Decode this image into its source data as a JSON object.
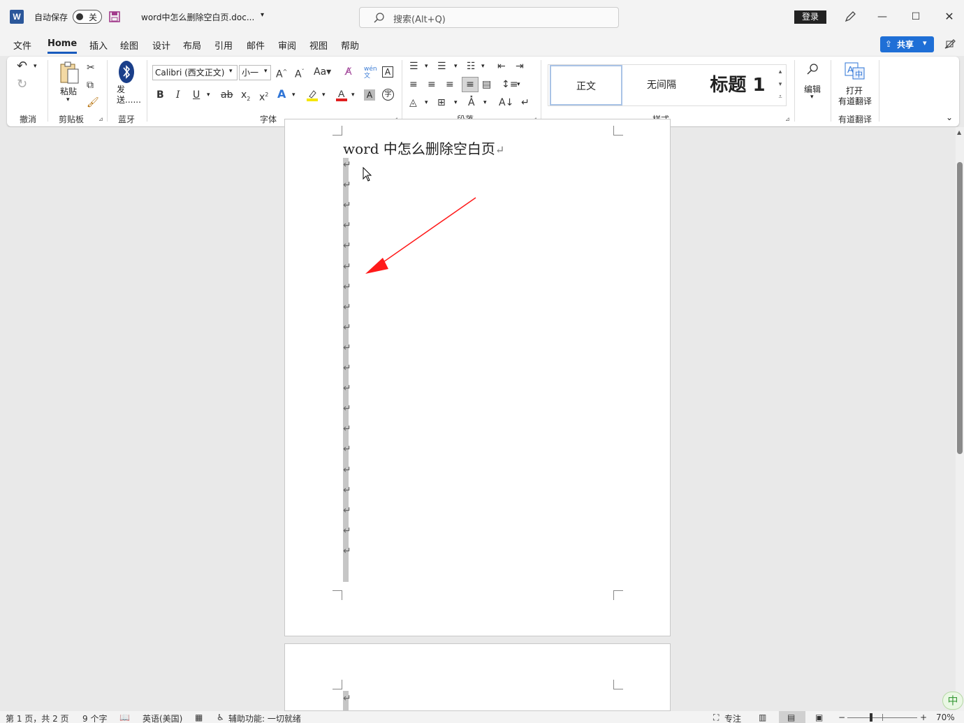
{
  "titlebar": {
    "autosave_label": "自动保存",
    "autosave_state": "关",
    "document_name": "word中怎么删除空白页.doc...",
    "search_placeholder": "搜索(Alt+Q)",
    "login_label": "登录"
  },
  "menu": {
    "items": [
      "文件",
      "Home",
      "插入",
      "绘图",
      "设计",
      "布局",
      "引用",
      "邮件",
      "审阅",
      "视图",
      "帮助"
    ],
    "active": "Home",
    "share_label": "共享"
  },
  "ribbon": {
    "undo_group": "撤消",
    "clipboard": {
      "paste_label": "粘贴",
      "group": "剪贴板"
    },
    "bluetooth": {
      "send_label": "发送......",
      "group": "蓝牙"
    },
    "font": {
      "name": "Calibri (西文正文)",
      "size": "小一",
      "group": "字体"
    },
    "paragraph_group": "段落",
    "styles": {
      "items": [
        "正文",
        "无间隔",
        "标题 1"
      ],
      "selected": "正文",
      "group": "样式"
    },
    "editing_label": "编辑",
    "youdao": {
      "open_label": "打开",
      "translate_label": "有道翻译",
      "group": "有道翻译"
    }
  },
  "document": {
    "title_text": "word 中怎么删除空白页",
    "pilcrow": "↵",
    "empty_paragraphs_page1": 20,
    "empty_paragraphs_page2": 1
  },
  "annotation": {
    "arrow_color": "#ff1a1a"
  },
  "statusbar": {
    "page_info": "第 1 页，共 2 页",
    "word_count": "9 个字",
    "language": "英语(美国)",
    "accessibility": "辅助功能: 一切就绪",
    "focus": "专注",
    "zoom": "70%"
  },
  "ime_label": "中",
  "colors": {
    "accent": "#185abd",
    "word_blue": "#2b579a",
    "share_blue": "#1f6fd6"
  }
}
